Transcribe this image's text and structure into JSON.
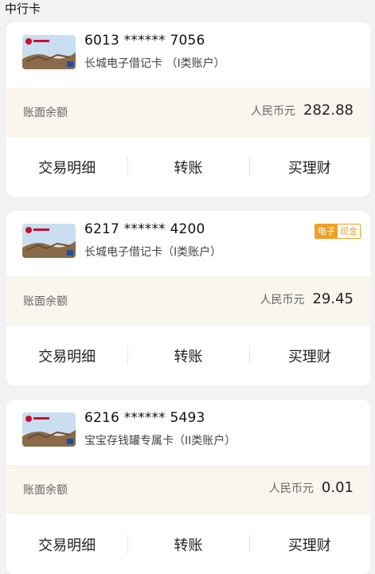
{
  "section_title": "中行卡",
  "balance_label": "账面余额",
  "currency": "人民币元",
  "actions": [
    "交易明细",
    "转账",
    "买理财"
  ],
  "cards": [
    {
      "number": "6013 ****** 7056",
      "name": "长城电子借记卡 （I类账户）",
      "balance": "282.88"
    },
    {
      "number": "6217 ****** 4200",
      "name": "长城电子借记卡（I类账户）",
      "balance": "29.45",
      "badge": {
        "left": "电子",
        "right": "现金"
      }
    },
    {
      "number": "6216 ****** 5493",
      "name": "宝宝存钱罐专属卡（II类账户）",
      "balance": "0.01"
    }
  ],
  "colors": {
    "badge": "#f0a020",
    "balance_bg": "#faf6ee",
    "page_bg": "#f2f2f2"
  }
}
